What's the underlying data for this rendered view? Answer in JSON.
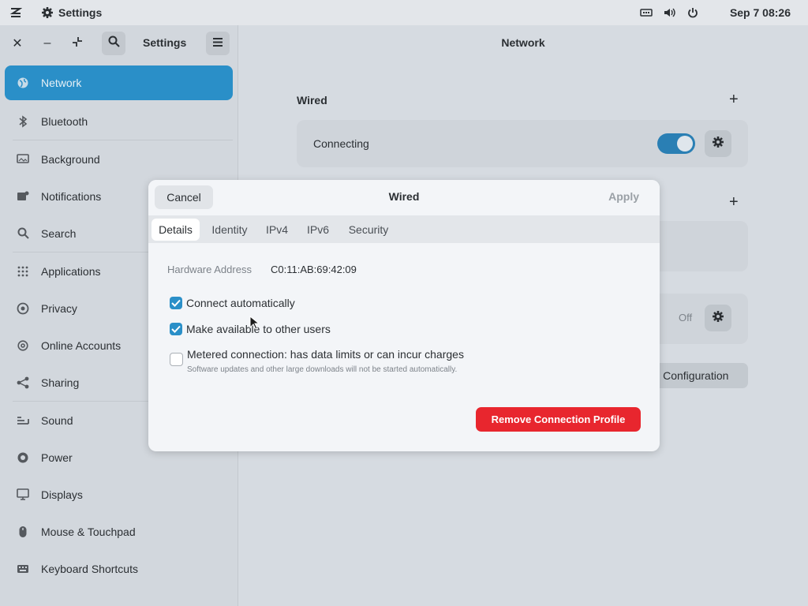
{
  "topbar": {
    "app_title": "Settings",
    "clock": "Sep 7  08:26"
  },
  "window": {
    "sidebar_title": "Settings",
    "content_title": "Network"
  },
  "sidebar": {
    "items": [
      {
        "label": "Network",
        "icon": "globe-icon"
      },
      {
        "label": "Bluetooth",
        "icon": "bluetooth-icon"
      },
      {
        "label": "Background",
        "icon": "monitor-icon"
      },
      {
        "label": "Notifications",
        "icon": "bell-icon"
      },
      {
        "label": "Search",
        "icon": "search-icon"
      },
      {
        "label": "Applications",
        "icon": "grid-icon"
      },
      {
        "label": "Privacy",
        "icon": "eye-icon"
      },
      {
        "label": "Online Accounts",
        "icon": "at-icon"
      },
      {
        "label": "Sharing",
        "icon": "share-icon"
      },
      {
        "label": "Sound",
        "icon": "sound-icon"
      },
      {
        "label": "Power",
        "icon": "power-icon"
      },
      {
        "label": "Displays",
        "icon": "display-icon"
      },
      {
        "label": "Mouse & Touchpad",
        "icon": "mouse-icon"
      },
      {
        "label": "Keyboard Shortcuts",
        "icon": "keyboard-icon"
      }
    ]
  },
  "content": {
    "wired_label": "Wired",
    "wired_status": "Connecting",
    "off_label": "Off",
    "config_label": "ll Configuration"
  },
  "dialog": {
    "cancel": "Cancel",
    "title": "Wired",
    "apply": "Apply",
    "tabs": [
      "Details",
      "Identity",
      "IPv4",
      "IPv6",
      "Security"
    ],
    "active_tab": "Details",
    "hw_label": "Hardware Address",
    "hw_value": "C0:11:AB:69:42:09",
    "connect_auto": "Connect automatically",
    "make_available": "Make available to other users",
    "metered": "Metered connection: has data limits or can incur charges",
    "metered_sub": "Software updates and other large downloads will not be started automatically.",
    "remove": "Remove Connection Profile"
  },
  "colors": {
    "accent": "#2a8fc8",
    "destructive": "#e8262e"
  }
}
